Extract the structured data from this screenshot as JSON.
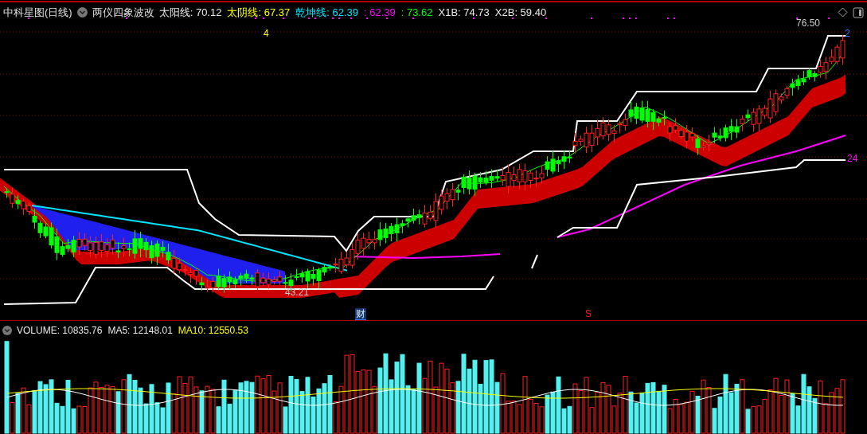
{
  "header": {
    "title": "中科星图(日线)",
    "indicator": "两仪四象波改",
    "legend": [
      {
        "label": "太阳线:",
        "value": "70.12",
        "color": "#e8e8e8"
      },
      {
        "label": "太阴线:",
        "value": "67.37",
        "color": "#ffff00"
      },
      {
        "label": "乾坤线:",
        "value": "62.39",
        "color": "#00e5ff"
      },
      {
        "label": ":",
        "value": "62.39",
        "color": "#ff00ff"
      },
      {
        "label": ":",
        "value": "73.62",
        "color": "#00ff00"
      },
      {
        "label": "X1B:",
        "value": "74.73",
        "color": "#e8e8e8"
      },
      {
        "label": "X2B:",
        "value": "59.40",
        "color": "#e8e8e8"
      }
    ]
  },
  "chart_labels": [
    {
      "kind": "plain",
      "text": "4",
      "color": "#ffff00"
    },
    {
      "kind": "arrow",
      "text": "76.50",
      "color": "#cccccc"
    },
    {
      "kind": "plain",
      "text": "2",
      "color": "#3a7bff"
    },
    {
      "kind": "plain",
      "text": "24",
      "color": "#ff00ff"
    },
    {
      "kind": "arrow",
      "text": "43.21",
      "color": "#cccccc"
    },
    {
      "kind": "tag",
      "text": "财",
      "color": "#3a7bff"
    },
    {
      "kind": "plain",
      "text": "S",
      "color": "#ff2020"
    }
  ],
  "volume_legend": [
    {
      "label": "VOLUME:",
      "value": "10835.76",
      "color": "#e8e8e8"
    },
    {
      "label": "MA5:",
      "value": "12148.01",
      "color": "#e8e8e8"
    },
    {
      "label": "MA10:",
      "value": "12550.53",
      "color": "#ffff00"
    }
  ]
}
